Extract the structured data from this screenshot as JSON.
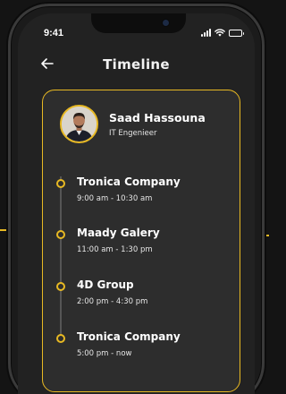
{
  "status_bar": {
    "time": "9:41"
  },
  "header": {
    "title": "Timeline"
  },
  "profile": {
    "name": "Saad Hassouna",
    "role": "IT Engenieer"
  },
  "timeline": [
    {
      "title": "Tronica Company",
      "time": "9:00 am - 10:30 am"
    },
    {
      "title": "Maady Galery",
      "time": "11:00 am - 1:30 pm"
    },
    {
      "title": "4D Group",
      "time": "2:00 pm - 4:30 pm"
    },
    {
      "title": "Tronica Company",
      "time": "5:00 pm - now"
    }
  ],
  "colors": {
    "accent": "#e8b923",
    "background": "#222222",
    "card": "#2d2d2d"
  },
  "icons": {
    "back": "arrow-left-icon",
    "battery": "battery-icon",
    "wifi": "wifi-icon",
    "signal": "signal-icon"
  }
}
